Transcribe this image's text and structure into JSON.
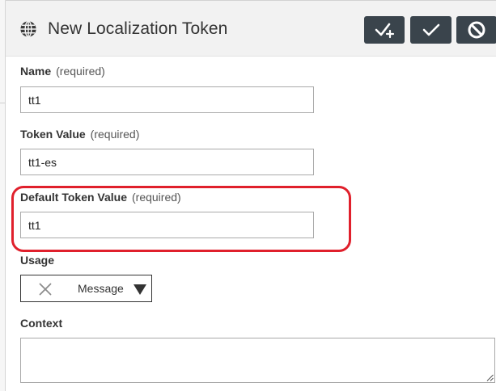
{
  "dialog": {
    "title": "New Localization Token",
    "icon": "globe-icon",
    "buttons": [
      {
        "name": "save-and-new-button",
        "icon": "check-plus-icon"
      },
      {
        "name": "save-button",
        "icon": "check-icon"
      },
      {
        "name": "cancel-button",
        "icon": "ban-icon"
      }
    ]
  },
  "fields": {
    "required_text": "(required)",
    "name": {
      "label": "Name",
      "value": "tt1"
    },
    "token_value": {
      "label": "Token Value",
      "value": "tt1-es"
    },
    "default_token_value": {
      "label": "Default Token Value",
      "value": "tt1"
    },
    "usage": {
      "label": "Usage",
      "value": "Message"
    },
    "context": {
      "label": "Context",
      "value": ""
    }
  },
  "colors": {
    "header_bg": "#f2f2f2",
    "button_bg": "#3a444c",
    "highlight": "#e0202c"
  }
}
